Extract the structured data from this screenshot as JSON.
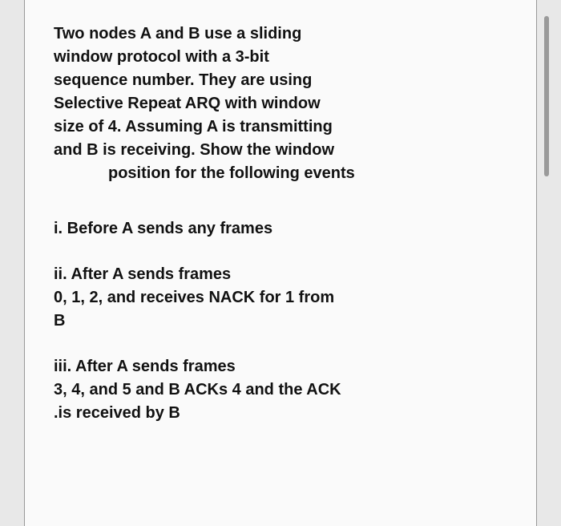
{
  "question": {
    "intro_lines": [
      "Two nodes A and B use a sliding",
      "window protocol with a 3-bit",
      "sequence number. They are using",
      "Selective Repeat ARQ with window",
      "size of 4. Assuming A is transmitting",
      "and B is receiving. Show the window"
    ],
    "intro_indent_line": "position for the following events",
    "items": [
      {
        "label": "i. Before A sends any frames"
      },
      {
        "label_line1": "ii. After A sends frames",
        "label_line2": "0, 1, 2, and receives NACK for 1 from",
        "label_line3": "B"
      },
      {
        "label_line1": "iii. After A sends frames",
        "label_line2": "3, 4, and 5 and B ACKs 4 and the ACK",
        "label_line3": ".is received by B"
      }
    ]
  }
}
